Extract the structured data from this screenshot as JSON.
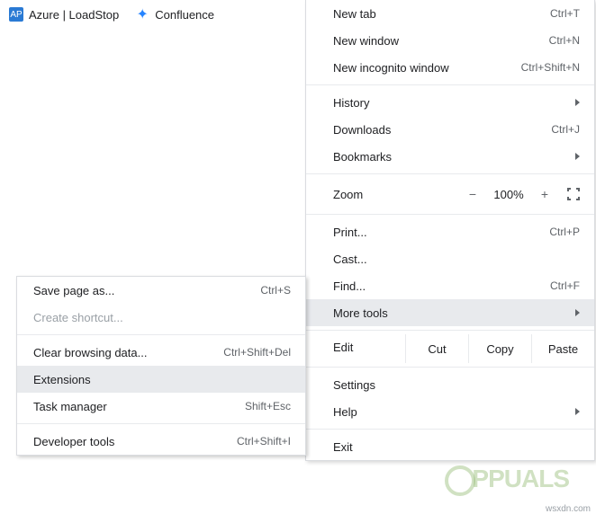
{
  "bookmarks": {
    "azure": "Azure | LoadStop",
    "confluence": "Confluence"
  },
  "menu": {
    "new_tab": {
      "label": "New tab",
      "shortcut": "Ctrl+T"
    },
    "new_window": {
      "label": "New window",
      "shortcut": "Ctrl+N"
    },
    "new_incognito": {
      "label": "New incognito window",
      "shortcut": "Ctrl+Shift+N"
    },
    "history": {
      "label": "History"
    },
    "downloads": {
      "label": "Downloads",
      "shortcut": "Ctrl+J"
    },
    "bookmarks": {
      "label": "Bookmarks"
    },
    "zoom": {
      "label": "Zoom",
      "minus": "−",
      "pct": "100%",
      "plus": "+"
    },
    "print": {
      "label": "Print...",
      "shortcut": "Ctrl+P"
    },
    "cast": {
      "label": "Cast..."
    },
    "find": {
      "label": "Find...",
      "shortcut": "Ctrl+F"
    },
    "more_tools": {
      "label": "More tools"
    },
    "edit": {
      "label": "Edit",
      "cut": "Cut",
      "copy": "Copy",
      "paste": "Paste"
    },
    "settings": {
      "label": "Settings"
    },
    "help": {
      "label": "Help"
    },
    "exit": {
      "label": "Exit"
    }
  },
  "submenu": {
    "save_page": {
      "label": "Save page as...",
      "shortcut": "Ctrl+S"
    },
    "create_shortcut": {
      "label": "Create shortcut..."
    },
    "clear_browsing": {
      "label": "Clear browsing data...",
      "shortcut": "Ctrl+Shift+Del"
    },
    "extensions": {
      "label": "Extensions"
    },
    "task_manager": {
      "label": "Task manager",
      "shortcut": "Shift+Esc"
    },
    "developer_tools": {
      "label": "Developer tools",
      "shortcut": "Ctrl+Shift+I"
    }
  },
  "watermark": {
    "logo": "PPUALS",
    "site": "wsxdn.com"
  }
}
